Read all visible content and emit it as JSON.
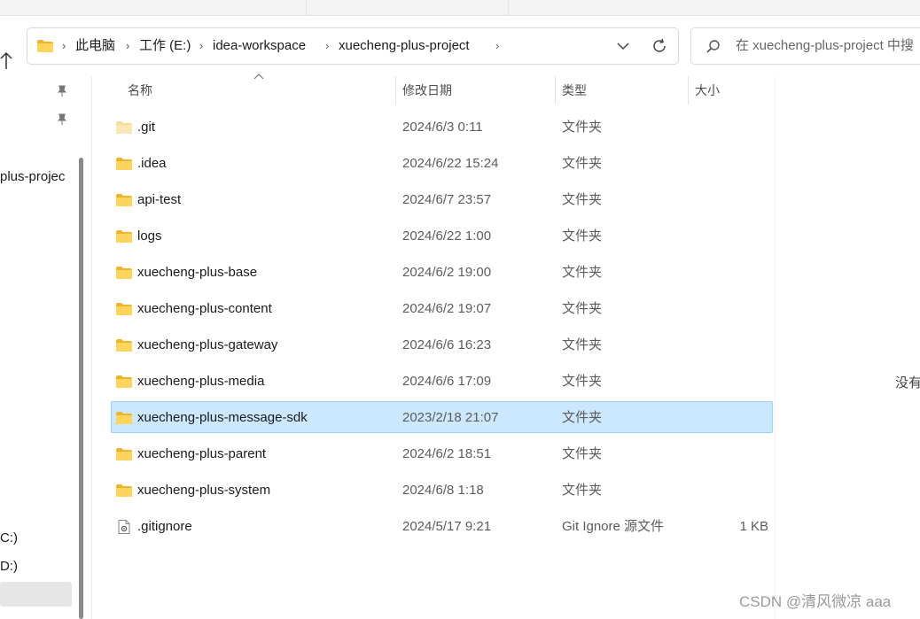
{
  "address_bar": {
    "breadcrumbs": [
      "此电脑",
      "工作 (E:)",
      "idea-workspace",
      "xuecheng-plus-project"
    ]
  },
  "search": {
    "placeholder": "在 xuecheng-plus-project 中搜"
  },
  "nav_pane": {
    "items": [
      {
        "label": "plus-projec"
      },
      {
        "label": "C:)"
      },
      {
        "label": "D:)"
      }
    ]
  },
  "columns": {
    "name": "名称",
    "date": "修改日期",
    "type": "类型",
    "size": "大小"
  },
  "files": [
    {
      "name": ".git",
      "date": "2024/6/3 0:11",
      "type": "文件夹",
      "size": "",
      "icon": "folder-faded-icon"
    },
    {
      "name": ".idea",
      "date": "2024/6/22 15:24",
      "type": "文件夹",
      "size": "",
      "icon": "folder-icon"
    },
    {
      "name": "api-test",
      "date": "2024/6/7 23:57",
      "type": "文件夹",
      "size": "",
      "icon": "folder-icon"
    },
    {
      "name": "logs",
      "date": "2024/6/22 1:00",
      "type": "文件夹",
      "size": "",
      "icon": "folder-icon"
    },
    {
      "name": "xuecheng-plus-base",
      "date": "2024/6/2 19:00",
      "type": "文件夹",
      "size": "",
      "icon": "folder-icon"
    },
    {
      "name": "xuecheng-plus-content",
      "date": "2024/6/2 19:07",
      "type": "文件夹",
      "size": "",
      "icon": "folder-icon"
    },
    {
      "name": "xuecheng-plus-gateway",
      "date": "2024/6/6 16:23",
      "type": "文件夹",
      "size": "",
      "icon": "folder-icon"
    },
    {
      "name": "xuecheng-plus-media",
      "date": "2024/6/6 17:09",
      "type": "文件夹",
      "size": "",
      "icon": "folder-icon"
    },
    {
      "name": "xuecheng-plus-message-sdk",
      "date": "2023/2/18 21:07",
      "type": "文件夹",
      "size": "",
      "icon": "folder-icon",
      "selected": true
    },
    {
      "name": "xuecheng-plus-parent",
      "date": "2024/6/2 18:51",
      "type": "文件夹",
      "size": "",
      "icon": "folder-icon"
    },
    {
      "name": "xuecheng-plus-system",
      "date": "2024/6/8 1:18",
      "type": "文件夹",
      "size": "",
      "icon": "folder-icon"
    },
    {
      "name": ".gitignore",
      "date": "2024/5/17 9:21",
      "type": "Git Ignore 源文件",
      "size": "1 KB",
      "icon": "file-settings-icon"
    }
  ],
  "preview_pane": {
    "text": "没有"
  },
  "watermark": "CSDN @清风微凉 aaa",
  "colors": {
    "selection_bg": "#cce8ff",
    "selection_border": "#99d1ff",
    "folder_yellow": "#f8c846"
  }
}
